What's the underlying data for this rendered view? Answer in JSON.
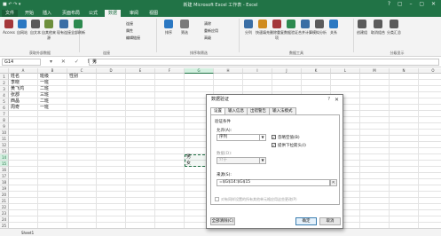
{
  "titlebar": {
    "title": "新建 Microsoft Excel 工作表 - Excel",
    "quick_access": "■ ↶ ↷ ▾",
    "window_controls": "? ▢ – ▢ ✕"
  },
  "tabs": [
    "开始",
    "插入",
    "页面布局",
    "公式",
    "数据",
    "审阅",
    "视图"
  ],
  "file_tab": "文件",
  "active_tab": "数据",
  "ribbon": {
    "buttons": [
      {
        "label": "Access",
        "icon": "access-icon",
        "color": "#a4373a"
      },
      {
        "label": "自网站",
        "icon": "web-icon",
        "color": "#2b78c2"
      },
      {
        "label": "自文本",
        "icon": "text-file-icon",
        "color": "#5b5b5b"
      },
      {
        "label": "自其他来源",
        "icon": "other-source-icon",
        "color": "#6d8f3c"
      },
      {
        "label": "现有连接",
        "icon": "connection-icon",
        "color": "#3a6ea5"
      },
      {
        "label": "全部刷新",
        "icon": "refresh-icon",
        "color": "#2d8a4f"
      },
      {
        "label": "排序",
        "icon": "sort-icon",
        "color": "#2b78c2"
      },
      {
        "label": "筛选",
        "icon": "filter-icon",
        "color": "#7a7a7a"
      },
      {
        "label": "分列",
        "icon": "text-to-columns-icon",
        "color": "#3a6ea5"
      },
      {
        "label": "快速填充",
        "icon": "flash-fill-icon",
        "color": "#d08b1f"
      },
      {
        "label": "删除重复项",
        "icon": "remove-duplicates-icon",
        "color": "#a4373a"
      },
      {
        "label": "数据验证",
        "icon": "data-validation-icon",
        "color": "#2d8a4f"
      },
      {
        "label": "合并计算",
        "icon": "consolidate-icon",
        "color": "#3a6ea5"
      },
      {
        "label": "模拟分析",
        "icon": "what-if-icon",
        "color": "#5b5b5b"
      },
      {
        "label": "关系",
        "icon": "relationships-icon",
        "color": "#2b78c2"
      },
      {
        "label": "创建组",
        "icon": "group-icon",
        "color": "#5b5b5b"
      },
      {
        "label": "取消组合",
        "icon": "ungroup-icon",
        "color": "#5b5b5b"
      },
      {
        "label": "分类汇总",
        "icon": "subtotal-icon",
        "color": "#5b5b5b"
      }
    ],
    "small_items": [
      "连接",
      "属性",
      "编辑链接",
      "清除",
      "重新应用",
      "高级"
    ],
    "groups": [
      "获取外部数据",
      "连接",
      "排序和筛选",
      "数据工具",
      "分级显示"
    ]
  },
  "formula_bar": {
    "name_box": "G14",
    "fx_icons": "▾ ✕ ✓ fx",
    "formula": "男"
  },
  "columns": [
    "A",
    "B",
    "C",
    "D",
    "E",
    "F",
    "G",
    "H",
    "I",
    "J",
    "K",
    "L",
    "M",
    "N",
    "O"
  ],
  "selected_column": "G",
  "rows": [
    "1",
    "2",
    "3",
    "4",
    "5",
    "6",
    "7",
    "8",
    "9",
    "10",
    "11",
    "12",
    "13",
    "14",
    "15",
    "16",
    "17",
    "18",
    "19",
    "20",
    "21",
    "22",
    "23",
    "24",
    "25"
  ],
  "selected_rows": [
    "14",
    "15"
  ],
  "cells": {
    "A1": "姓名",
    "B1": "班级",
    "C1": "性别",
    "A2": "李晓",
    "B2": "一班",
    "A3": "黄飞鸿",
    "B3": "二班",
    "A4": "张郡",
    "B4": "三班",
    "A5": "西晶",
    "B5": "二班",
    "A6": "周奇",
    "B6": "一班",
    "G14": "男",
    "G15": "女"
  },
  "dialog": {
    "title": "数据验证",
    "help": "?",
    "close": "✕",
    "tabs": [
      "设置",
      "输入信息",
      "出错警告",
      "输入法模式"
    ],
    "active_tab": "设置",
    "criteria_heading": "验证条件",
    "allow_label": "允许(A):",
    "allow_value": "序列",
    "ignore_blank": "忽略空值(B)",
    "in_cell_dropdown": "提供下拉箭头(I)",
    "data_label": "数据(D):",
    "data_value": "介于",
    "source_label": "来源(S):",
    "source_value": "=$G$14:$G$15",
    "apply_all": "对有同样设置的所有其他单元格应用这些更改(P)",
    "clear_all": "全部清除(C)",
    "ok": "确定",
    "cancel": "取消"
  },
  "sheetbar": {
    "sheet": "Sheet1"
  }
}
